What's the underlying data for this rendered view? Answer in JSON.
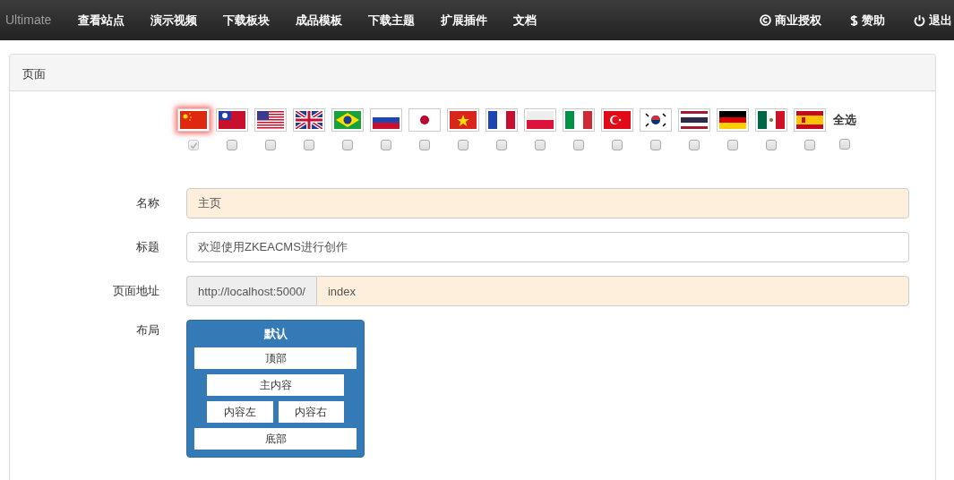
{
  "navbar": {
    "brand": "Ultimate",
    "items": [
      "查看站点",
      "演示视频",
      "下载板块",
      "成品模板",
      "下载主题",
      "扩展插件",
      "文档"
    ],
    "right_items": [
      {
        "kind": "copyright",
        "label": "商业授权"
      },
      {
        "kind": "dollar",
        "label": "赞助"
      },
      {
        "kind": "power",
        "label": "退出"
      }
    ]
  },
  "panel": {
    "title": "页面"
  },
  "languages": [
    {
      "kind": "cn",
      "selected": true,
      "checked": true,
      "disabled": true
    },
    {
      "kind": "tw",
      "selected": false,
      "checked": false,
      "disabled": false
    },
    {
      "kind": "us",
      "selected": false,
      "checked": false,
      "disabled": false
    },
    {
      "kind": "gb",
      "selected": false,
      "checked": false,
      "disabled": false
    },
    {
      "kind": "br",
      "selected": false,
      "checked": false,
      "disabled": false
    },
    {
      "kind": "ru",
      "selected": false,
      "checked": false,
      "disabled": false
    },
    {
      "kind": "jp",
      "selected": false,
      "checked": false,
      "disabled": false
    },
    {
      "kind": "vn",
      "selected": false,
      "checked": false,
      "disabled": false
    },
    {
      "kind": "fr",
      "selected": false,
      "checked": false,
      "disabled": false
    },
    {
      "kind": "pl",
      "selected": false,
      "checked": false,
      "disabled": false
    },
    {
      "kind": "it",
      "selected": false,
      "checked": false,
      "disabled": false
    },
    {
      "kind": "tr",
      "selected": false,
      "checked": false,
      "disabled": false
    },
    {
      "kind": "kr",
      "selected": false,
      "checked": false,
      "disabled": false
    },
    {
      "kind": "th",
      "selected": false,
      "checked": false,
      "disabled": false
    },
    {
      "kind": "de",
      "selected": false,
      "checked": false,
      "disabled": false
    },
    {
      "kind": "mx",
      "selected": false,
      "checked": false,
      "disabled": false
    },
    {
      "kind": "es",
      "selected": false,
      "checked": false,
      "disabled": false
    }
  ],
  "select_all": {
    "label": "全选",
    "checked": false
  },
  "form": {
    "name": {
      "label": "名称",
      "value": "主页"
    },
    "title": {
      "label": "标题",
      "value": "欢迎使用ZKEACMS进行创作"
    },
    "url": {
      "label": "页面地址",
      "prefix": "http://localhost:5000/",
      "value": "index"
    },
    "layout": {
      "label": "布局",
      "name": "默认",
      "header": "顶部",
      "main": "主内容",
      "left": "内容左",
      "right": "内容右",
      "footer": "底部"
    }
  }
}
